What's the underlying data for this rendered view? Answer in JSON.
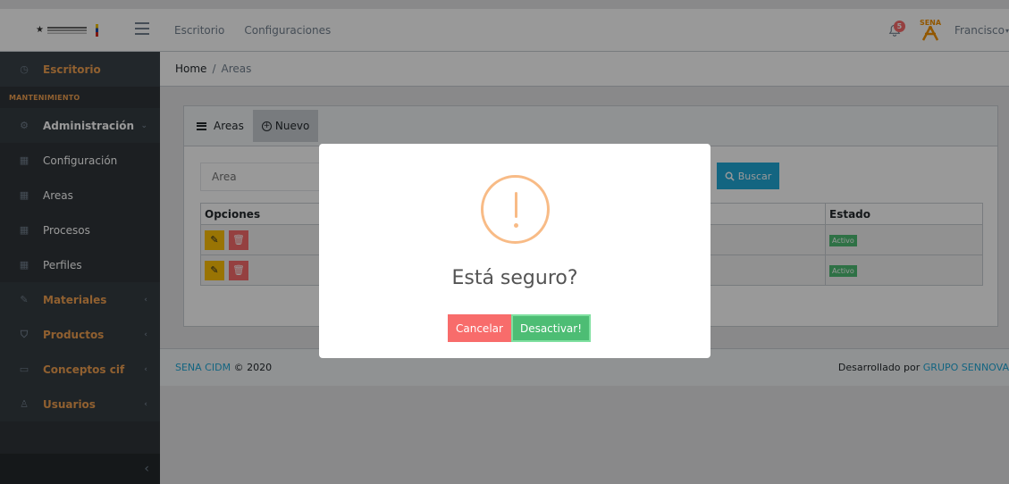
{
  "header": {
    "nav": [
      "Escritorio",
      "Configuraciones"
    ],
    "notifications": "5",
    "user": "Francisco"
  },
  "sidebar": {
    "escritorio": "Escritorio",
    "section": "MANTENIMIENTO",
    "items": [
      {
        "label": "Administración"
      },
      {
        "label": "Configuración"
      },
      {
        "label": "Areas"
      },
      {
        "label": "Procesos"
      },
      {
        "label": "Perfiles"
      },
      {
        "label": "Materiales"
      },
      {
        "label": "Productos"
      },
      {
        "label": "Conceptos cif"
      },
      {
        "label": "Usuarios"
      }
    ]
  },
  "breadcrumb": {
    "home": "Home",
    "separator": "/",
    "current": "Areas"
  },
  "card": {
    "title": "Areas",
    "new_button": "Nuevo",
    "search_placeholder": "Area",
    "search_button": "Buscar",
    "columns": {
      "options": "Opciones",
      "state": "Estado"
    },
    "rows": [
      {
        "state": "Activo"
      },
      {
        "state": "Activo"
      }
    ]
  },
  "footer": {
    "brand": "SENA CIDM",
    "copy": "© 2020",
    "dev_prefix": "Desarrollado por",
    "dev_link": "GRUPO SENNOVA"
  },
  "modal": {
    "title": "Está seguro?",
    "cancel": "Cancelar",
    "confirm": "Desactivar!"
  },
  "colors": {
    "sidebar": "#2f353a",
    "accent_orange": "#f0a050",
    "primary": "#20a8d8",
    "success": "#4dbd74",
    "danger": "#f86c6b",
    "warning": "#ffc107"
  }
}
